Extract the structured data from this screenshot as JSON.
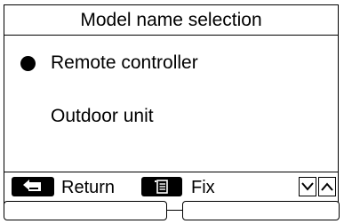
{
  "screen": {
    "title": "Model name selection"
  },
  "options": [
    {
      "label": "Remote controller",
      "selected": true
    },
    {
      "label": "Outdoor unit",
      "selected": false
    }
  ],
  "footer": {
    "return_label": "Return",
    "fix_label": "Fix",
    "return_icon": "return-arrow-icon",
    "menu_icon": "menu-list-icon",
    "down_icon": "chevron-down-icon",
    "up_icon": "chevron-up-icon"
  }
}
